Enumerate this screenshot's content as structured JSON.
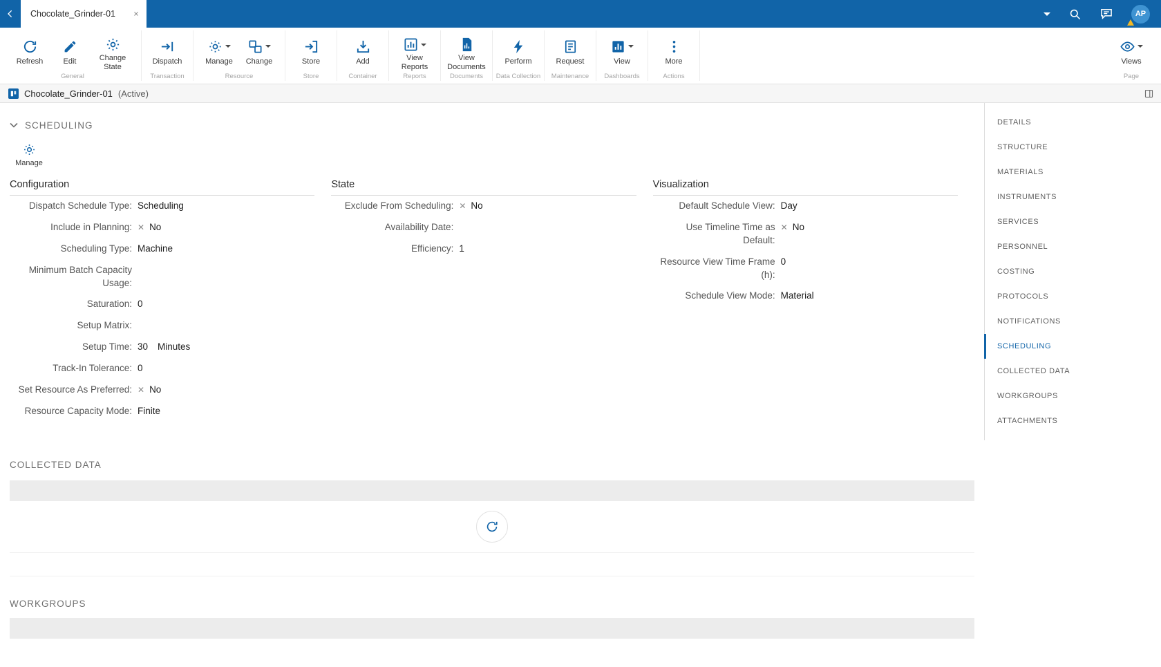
{
  "colors": {
    "accent": "#1164a8",
    "topbar": "#1164a8",
    "warning": "#f2b824"
  },
  "symbols": {
    "false_mark": "✕"
  },
  "topbar": {
    "tab": {
      "title": "Chocolate_Grinder-01"
    },
    "avatar": "AP"
  },
  "ribbon": {
    "groups": [
      {
        "label": "General",
        "buttons": [
          {
            "label": "Refresh"
          },
          {
            "label": "Edit"
          },
          {
            "label": "Change State"
          }
        ]
      },
      {
        "label": "Transaction",
        "buttons": [
          {
            "label": "Dispatch"
          }
        ]
      },
      {
        "label": "Resource",
        "buttons": [
          {
            "label": "Manage",
            "caret": true
          },
          {
            "label": "Change",
            "caret": true
          }
        ]
      },
      {
        "label": "Store",
        "buttons": [
          {
            "label": "Store"
          }
        ]
      },
      {
        "label": "Container",
        "buttons": [
          {
            "label": "Add"
          }
        ]
      },
      {
        "label": "Reports",
        "buttons": [
          {
            "label": "View Reports",
            "caret": true
          }
        ]
      },
      {
        "label": "Documents",
        "buttons": [
          {
            "label": "View Documents"
          }
        ]
      },
      {
        "label": "Data Collection",
        "buttons": [
          {
            "label": "Perform"
          }
        ]
      },
      {
        "label": "Maintenance",
        "buttons": [
          {
            "label": "Request"
          }
        ]
      },
      {
        "label": "Dashboards",
        "buttons": [
          {
            "label": "View",
            "caret": true
          }
        ]
      },
      {
        "label": "Actions",
        "buttons": [
          {
            "label": "More"
          }
        ]
      },
      {
        "label": "Page",
        "buttons": [
          {
            "label": "Views",
            "caret": true
          }
        ]
      }
    ]
  },
  "breadcrumb": {
    "title": "Chocolate_Grinder-01",
    "status": "(Active)"
  },
  "scheduling": {
    "title": "SCHEDULING",
    "manage_label": "Manage",
    "columns": [
      {
        "title": "Configuration",
        "fields": [
          {
            "label": "Dispatch Schedule Type:",
            "value": "Scheduling"
          },
          {
            "label": "Include in Planning:",
            "value": "No",
            "false_mark": true
          },
          {
            "label": "Scheduling Type:",
            "value": "Machine"
          },
          {
            "label": "Minimum Batch Capacity Usage:",
            "value": ""
          },
          {
            "label": "Saturation:",
            "value": "0"
          },
          {
            "label": "Setup Matrix:",
            "value": ""
          },
          {
            "label": "Setup Time:",
            "value": "30",
            "unit": "Minutes"
          },
          {
            "label": "Track-In Tolerance:",
            "value": "0"
          },
          {
            "label": "Set Resource As Preferred:",
            "value": "No",
            "false_mark": true
          },
          {
            "label": "Resource Capacity Mode:",
            "value": "Finite"
          }
        ]
      },
      {
        "title": "State",
        "fields": [
          {
            "label": "Exclude From Scheduling:",
            "value": "No",
            "false_mark": true
          },
          {
            "label": "Availability Date:",
            "value": ""
          },
          {
            "label": "Efficiency:",
            "value": "1"
          }
        ]
      },
      {
        "title": "Visualization",
        "fields": [
          {
            "label": "Default Schedule View:",
            "value": "Day"
          },
          {
            "label": "Use Timeline Time as Default:",
            "value": "No",
            "false_mark": true
          },
          {
            "label": "Resource View Time Frame (h):",
            "value": "0"
          },
          {
            "label": "Schedule View Mode:",
            "value": "Material"
          }
        ]
      }
    ]
  },
  "collected_data": {
    "title": "COLLECTED DATA"
  },
  "workgroups": {
    "title": "WORKGROUPS"
  },
  "sidebar": {
    "items": [
      {
        "label": "DETAILS"
      },
      {
        "label": "STRUCTURE"
      },
      {
        "label": "MATERIALS"
      },
      {
        "label": "INSTRUMENTS"
      },
      {
        "label": "SERVICES"
      },
      {
        "label": "PERSONNEL"
      },
      {
        "label": "COSTING"
      },
      {
        "label": "PROTOCOLS"
      },
      {
        "label": "NOTIFICATIONS"
      },
      {
        "label": "SCHEDULING",
        "active": true
      },
      {
        "label": "COLLECTED DATA"
      },
      {
        "label": "WORKGROUPS"
      },
      {
        "label": "ATTACHMENTS"
      }
    ]
  }
}
